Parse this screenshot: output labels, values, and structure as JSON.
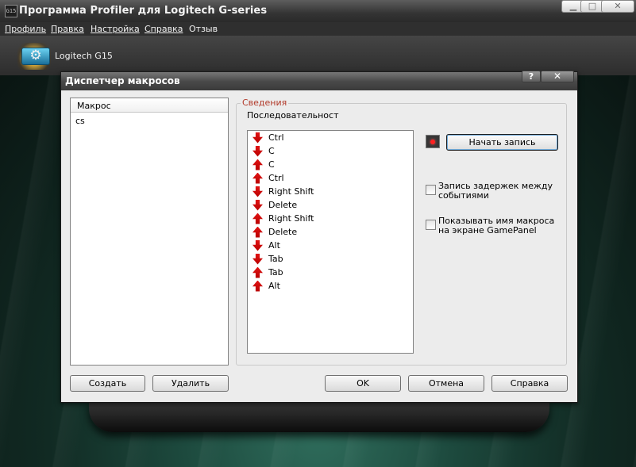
{
  "app": {
    "title": "Программа Profiler для Logitech G-series",
    "icon_text": "G15",
    "window_buttons": {
      "minimize": "▁",
      "maximize": "□",
      "close": "✕"
    }
  },
  "menu": {
    "items": [
      {
        "label": "Профиль"
      },
      {
        "label": "Правка"
      },
      {
        "label": "Настройка"
      },
      {
        "label": "Справка"
      },
      {
        "label": "Отзыв"
      }
    ]
  },
  "device": {
    "name": "Logitech G15"
  },
  "dialog": {
    "title": "Диспетчер макросов",
    "help_glyph": "?",
    "close_glyph": "✕",
    "macro_list": {
      "header": "Макрос",
      "items": [
        "cs"
      ]
    },
    "details": {
      "group_title": "Сведения",
      "sequence_label": "Последовательност",
      "sequence": [
        {
          "dir": "down",
          "key": "Ctrl"
        },
        {
          "dir": "down",
          "key": "C"
        },
        {
          "dir": "up",
          "key": "C"
        },
        {
          "dir": "up",
          "key": "Ctrl"
        },
        {
          "dir": "down",
          "key": "Right Shift"
        },
        {
          "dir": "down",
          "key": "Delete"
        },
        {
          "dir": "up",
          "key": "Right Shift"
        },
        {
          "dir": "up",
          "key": "Delete"
        },
        {
          "dir": "down",
          "key": "Alt"
        },
        {
          "dir": "down",
          "key": "Tab"
        },
        {
          "dir": "up",
          "key": "Tab"
        },
        {
          "dir": "up",
          "key": "Alt"
        }
      ],
      "record_button": "Начать запись",
      "record_delays": {
        "label": "Запись задержек между событиями",
        "checked": false
      },
      "show_name": {
        "label": "Показывать имя макроса на экране GamePanel",
        "checked": false
      }
    },
    "buttons": {
      "create": "Создать",
      "delete": "Удалить",
      "ok": "OK",
      "cancel": "Отмена",
      "help": "Справка"
    }
  },
  "colors": {
    "arrow": "#d40000",
    "legend": "#b23a2a",
    "record": "#ff2020"
  }
}
